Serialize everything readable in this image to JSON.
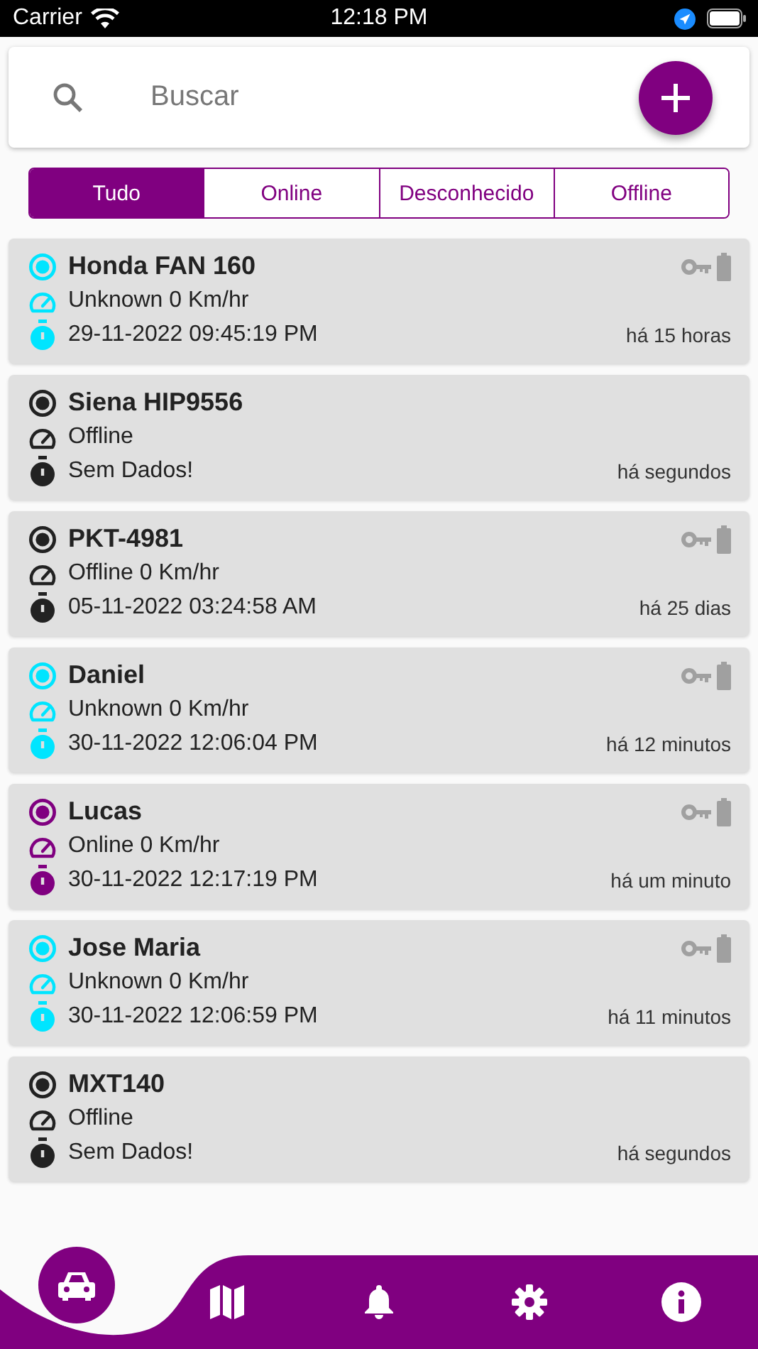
{
  "status_bar": {
    "carrier": "Carrier",
    "time": "12:18 PM"
  },
  "search": {
    "placeholder": "Buscar"
  },
  "filters": [
    {
      "label": "Tudo",
      "selected": true
    },
    {
      "label": "Online",
      "selected": false
    },
    {
      "label": "Desconhecido",
      "selected": false
    },
    {
      "label": "Offline",
      "selected": false
    }
  ],
  "vehicles": [
    {
      "name": "Honda FAN 160",
      "color": "#00e5ff",
      "speed": "Unknown 0 Km/hr",
      "datetime": "29-11-2022 09:45:19 PM",
      "ago": "há 15 horas",
      "indicators": true
    },
    {
      "name": "Siena HIP9556",
      "color": "#222222",
      "speed": "Offline",
      "datetime": "Sem Dados!",
      "ago": "há segundos",
      "indicators": false
    },
    {
      "name": "PKT-4981",
      "color": "#222222",
      "speed": "Offline 0 Km/hr",
      "datetime": "05-11-2022 03:24:58 AM",
      "ago": "há 25 dias",
      "indicators": true
    },
    {
      "name": "Daniel",
      "color": "#00e5ff",
      "speed": "Unknown 0 Km/hr",
      "datetime": "30-11-2022 12:06:04 PM",
      "ago": "há 12 minutos",
      "indicators": true
    },
    {
      "name": "Lucas",
      "color": "#800080",
      "speed": "Online 0 Km/hr",
      "datetime": "30-11-2022 12:17:19 PM",
      "ago": "há um minuto",
      "indicators": true
    },
    {
      "name": "Jose Maria",
      "color": "#00e5ff",
      "speed": "Unknown 0 Km/hr",
      "datetime": "30-11-2022 12:06:59 PM",
      "ago": "há 11 minutos",
      "indicators": true
    },
    {
      "name": "MXT140",
      "color": "#222222",
      "speed": "Offline",
      "datetime": "Sem Dados!",
      "ago": "há segundos",
      "indicators": false
    }
  ],
  "nav": [
    {
      "kind": "car",
      "selected": true
    },
    {
      "kind": "map",
      "selected": false
    },
    {
      "kind": "bell",
      "selected": false
    },
    {
      "kind": "gear",
      "selected": false
    },
    {
      "kind": "info",
      "selected": false
    }
  ]
}
